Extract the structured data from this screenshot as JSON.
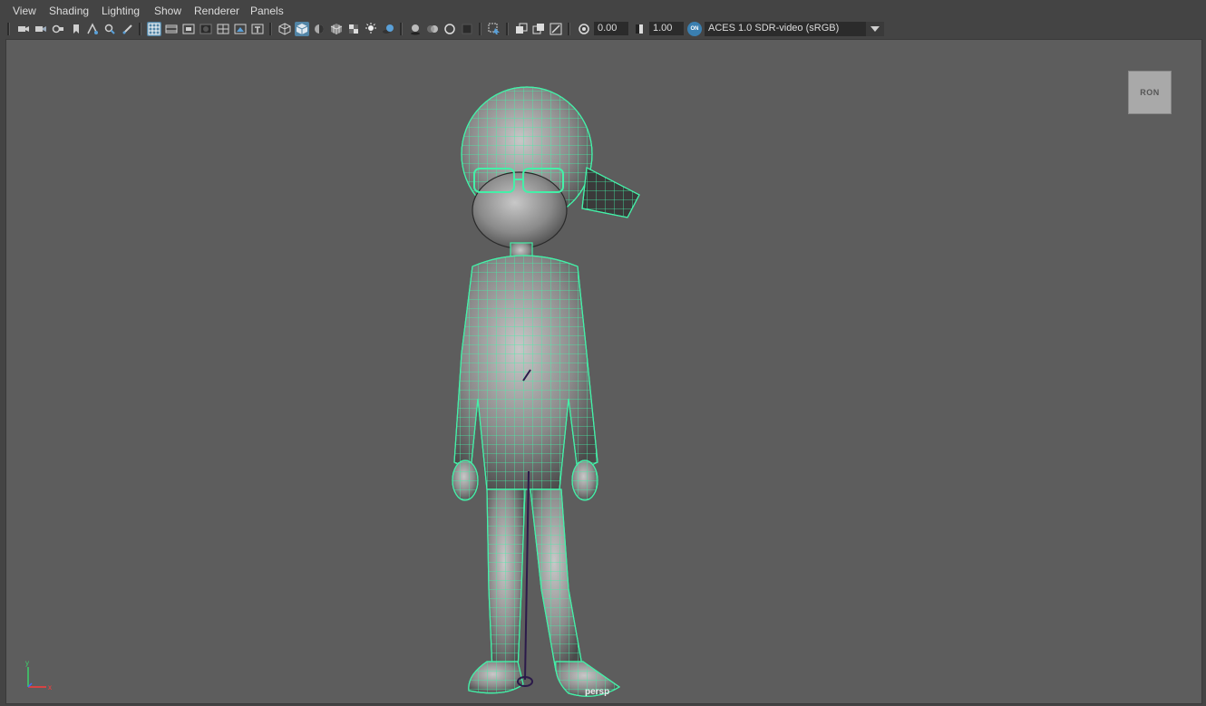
{
  "menu": {
    "items": [
      "View",
      "Shading",
      "Lighting",
      "Show",
      "Renderer",
      "Panels"
    ]
  },
  "toolbar": {
    "exposure_value": "0.00",
    "gamma_value": "1.00",
    "color_management_badge": "ON",
    "view_transform": "ACES 1.0 SDR-video (sRGB)"
  },
  "viewport": {
    "camera_name": "persp",
    "viewcube_label": "RON",
    "wireframe_color": "#44f0a8",
    "background_color": "#5d5d5d",
    "axis": {
      "x_label": "x",
      "y_label": "y",
      "x_color": "#ff3b3b",
      "y_color": "#3bd36b",
      "z_color": "#3b6bff"
    }
  },
  "icons": {
    "camera": "camera-icon",
    "grid": "grid-icon",
    "wireframe": "wireframe-icon",
    "smooth_shade": "smooth-shade-icon",
    "lights": "light-icon",
    "exposure": "exposure-icon",
    "gamma": "gamma-icon",
    "dropdown": "chevron-down-icon"
  }
}
